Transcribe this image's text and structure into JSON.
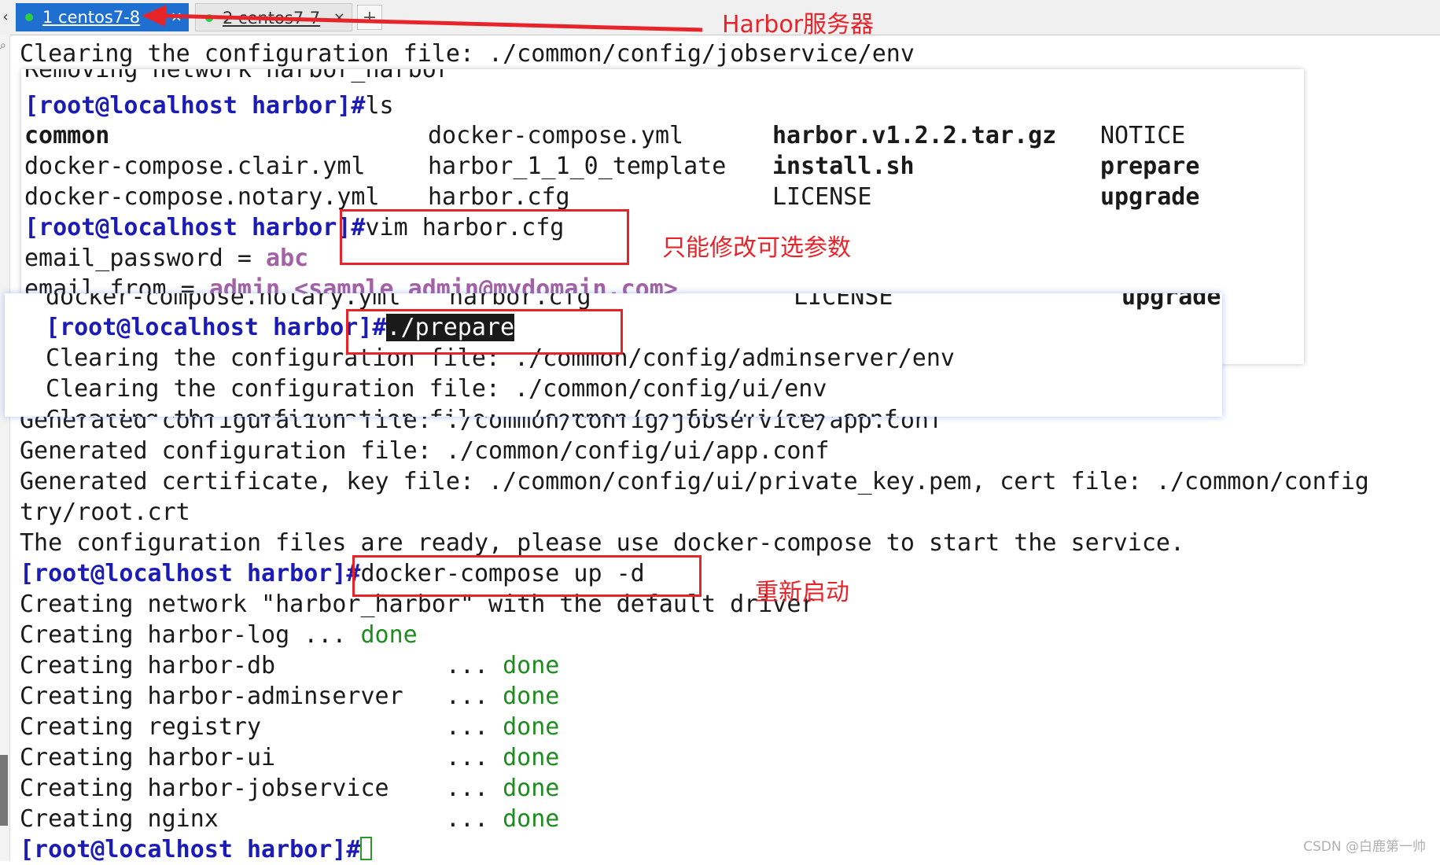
{
  "tabs": [
    {
      "label": "1 centos7-8",
      "active": true
    },
    {
      "label": "2 centos7-7",
      "active": false
    }
  ],
  "annotations": {
    "server": "Harbor服务器",
    "edit_only": "只能修改可选参数",
    "restart": "重新启动"
  },
  "terminal": {
    "top_line": "Clearing the configuration file: ./common/config/jobservice/env",
    "overlay1": {
      "cut_line": "Removing network harbor_harbor",
      "prompt": "[root@localhost harbor]#",
      "cmd_ls": "ls",
      "files_row1": [
        "common",
        "docker-compose.yml",
        "harbor.v1.2.2.tar.gz",
        "NOTICE"
      ],
      "files_row2": [
        "docker-compose.clair.yml",
        "harbor_1_1_0_template",
        "install.sh",
        "prepare"
      ],
      "files_row3": [
        "docker-compose.notary.yml",
        "harbor.cfg",
        "LICENSE",
        "upgrade"
      ],
      "cmd_vim": "vim harbor.cfg",
      "email_password_key": "email_password = ",
      "email_password_val": "abc",
      "email_from_key": "email_from = ",
      "email_from_val": "admin <sample_admin@mydomain.com>"
    },
    "overlay2": {
      "cut_row": [
        "docker-compose.notary.yml",
        "harbor.cfg",
        "LICENSE",
        "upgrade"
      ],
      "prompt": "[root@localhost harbor]#",
      "cmd_prepare": "./prepare",
      "line1": "Clearing the configuration file: ./common/config/adminserver/env",
      "line2": "Clearing the configuration file: ./common/config/ui/env",
      "line3_partial": "Clearing the configuration file: ./common/config/ui/app.conf"
    },
    "lines": [
      "Generated configuration file: ./common/config/jobservice/app.conf",
      "Generated configuration file: ./common/config/ui/app.conf",
      "Generated certificate, key file: ./common/config/ui/private_key.pem, cert file: ./common/config",
      "try/root.crt",
      "The configuration files are ready, please use docker-compose to start the service."
    ],
    "prompt": "[root@localhost harbor]#",
    "cmd_up": "docker-compose up -d",
    "network_line": "Creating network \"harbor_harbor\" with the default driver",
    "creating_log": "Creating harbor-log ... ",
    "creating": [
      {
        "name": "Creating harbor-db            ... ",
        "status": "done"
      },
      {
        "name": "Creating harbor-adminserver   ... ",
        "status": "done"
      },
      {
        "name": "Creating registry             ... ",
        "status": "done"
      },
      {
        "name": "Creating harbor-ui            ... ",
        "status": "done"
      },
      {
        "name": "Creating harbor-jobservice    ... ",
        "status": "done"
      },
      {
        "name": "Creating nginx                ... ",
        "status": "done"
      }
    ],
    "done_label": "done"
  },
  "watermark": "CSDN @白鹿第一帅"
}
